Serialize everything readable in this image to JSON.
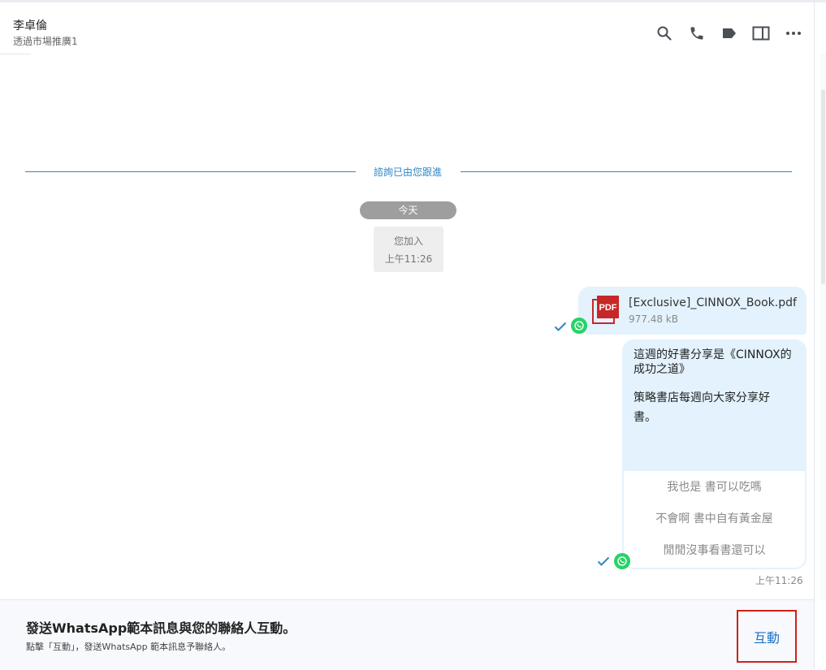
{
  "header": {
    "contact_name": "李卓倫",
    "contact_subtitle": "透過市場推廣1",
    "icons": [
      "search-icon",
      "phone-icon",
      "tag-icon",
      "panel-icon",
      "more-icon"
    ]
  },
  "conversation": {
    "divider_text": "諮詢已由您跟進",
    "date_chip": "今天",
    "system_event": {
      "text": "您加入",
      "time": "上午11:26"
    },
    "file_message": {
      "file_name": "[Exclusive]_CINNOX_Book.pdf",
      "file_size": "977.48 kB",
      "icon": "pdf-file-icon",
      "pdf_label": "PDF"
    },
    "template_message": {
      "body_line1": "這週的好書分享是《CINNOX的成功之道》",
      "body_line2": "策略書店每週向大家分享好書。",
      "buttons": [
        "我也是 書可以吃嗎",
        "不會啊 書中自有黃金屋",
        "閒閒沒事看書還可以"
      ],
      "time": "上午11:26"
    }
  },
  "footer": {
    "title": "發送WhatsApp範本訊息與您的聯絡人互動。",
    "subtitle": "點擊「互動」，發送WhatsApp 範本訊息予聯絡人。",
    "action_label": "互動"
  },
  "colors": {
    "accent": "#2f86c5",
    "bubble": "#e3f2fd",
    "whatsapp": "#25d366",
    "highlight_border": "#d0201a"
  }
}
